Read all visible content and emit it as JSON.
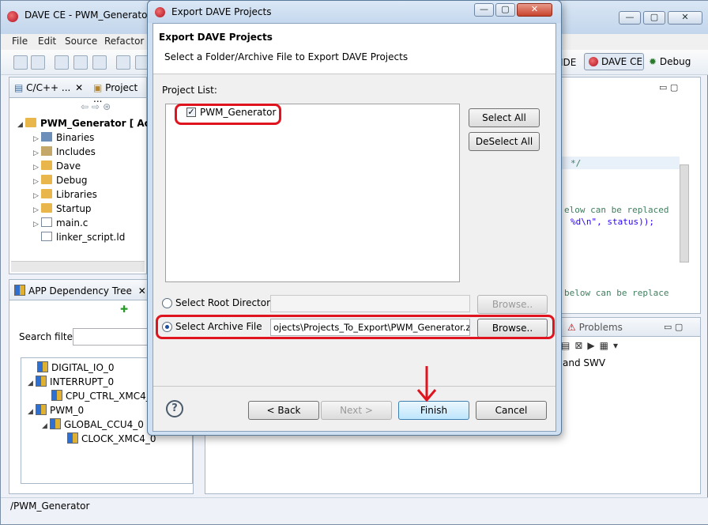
{
  "ide": {
    "title": "DAVE CE - PWM_Generator/m",
    "menus": [
      "File",
      "Edit",
      "Source",
      "Refactor"
    ],
    "perspectives": {
      "ide_label": "IDE",
      "dave_label": "DAVE CE",
      "debug_label": "Debug"
    },
    "left_tabs": {
      "cpp": "C/C++ ...",
      "project": "Project ..."
    },
    "project_tree": {
      "root": "PWM_Generator [ Activ",
      "children": [
        "Binaries",
        "Includes",
        "Dave",
        "Debug",
        "Libraries",
        "Startup",
        "main.c",
        "linker_script.ld"
      ]
    },
    "app_tree": {
      "title": "APP Dependency Tree",
      "search_label": "Search filter",
      "rows": [
        "DIGITAL_IO_0",
        "INTERRUPT_0",
        "CPU_CTRL_XMC4_0",
        "PWM_0",
        "GLOBAL_CCU4_0",
        "CLOCK_XMC4_0"
      ]
    },
    "editor_lines": [
      "*/",
      "elow can be replaced",
      "%d\\n\", status));",
      "below can be replace"
    ],
    "problems_tab": "Problems",
    "console_text": "and SWV",
    "status_bar": "/PWM_Generator"
  },
  "dialog": {
    "window_title": "Export DAVE Projects",
    "header_title": "Export DAVE Projects",
    "header_subtitle": "Select a Folder/Archive File to Export DAVE Projects",
    "project_list_label": "Project List:",
    "projects": [
      {
        "name": "PWM_Generator",
        "checked": true
      }
    ],
    "select_all": "Select All",
    "deselect_all": "DeSelect All",
    "root_dir_label": "Select Root Directory",
    "root_dir_value": "",
    "archive_label": "Select Archive File",
    "archive_value": "ojects\\Projects_To_Export\\PWM_Generator.zip",
    "browse_label": "Browse..",
    "back_label": "< Back",
    "next_label": "Next >",
    "finish_label": "Finish",
    "cancel_label": "Cancel",
    "help_glyph": "?",
    "selected_option": "archive"
  },
  "colors": {
    "highlight": "#e0141e",
    "accent": "#3c7fb1"
  }
}
